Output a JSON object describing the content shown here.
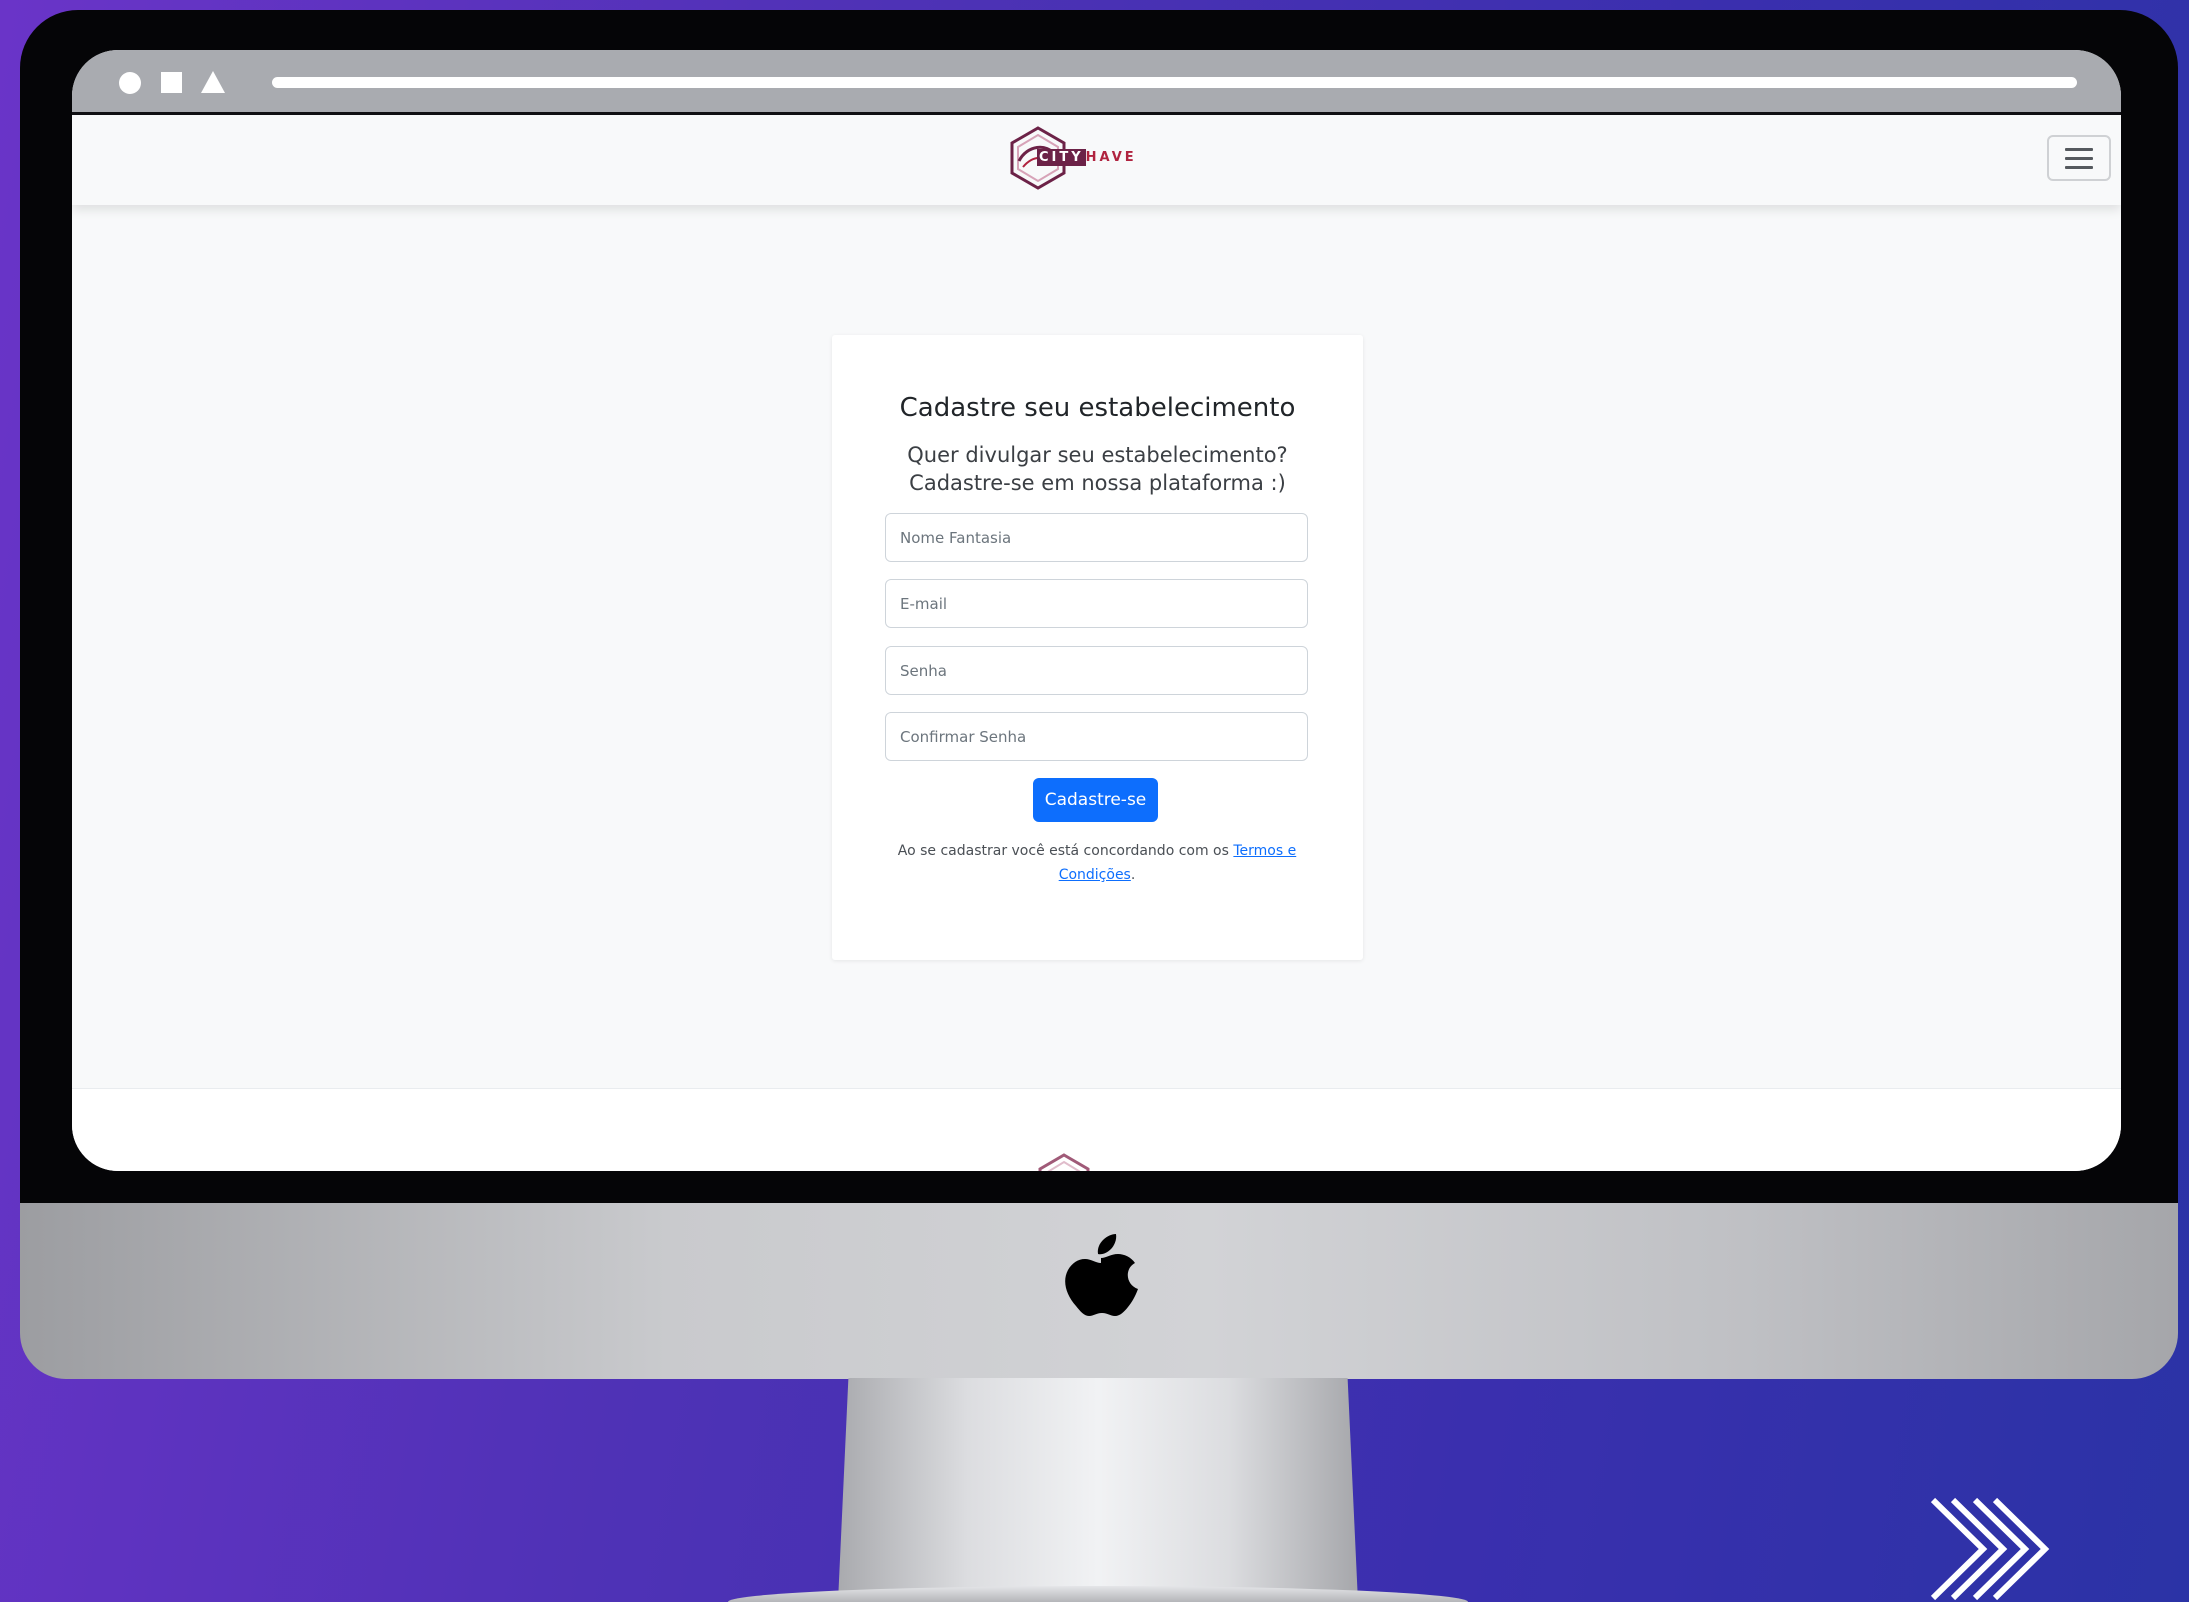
{
  "brand": {
    "logo_text_first": "CITY",
    "logo_text_rest": "HAVE"
  },
  "navbar": {
    "menu_icon": "hamburger-icon"
  },
  "signup": {
    "title": "Cadastre seu estabelecimento",
    "subtitle_line1": "Quer divulgar seu estabelecimento?",
    "subtitle_line2": "Cadastre-se em nossa plataforma :)",
    "fields": {
      "trade_name_placeholder": "Nome Fantasia",
      "email_placeholder": "E-mail",
      "password_placeholder": "Senha",
      "confirm_password_placeholder": "Confirmar Senha"
    },
    "submit_label": "Cadastre-se",
    "terms_text": "Ao se cadastrar você está concordando com os ",
    "terms_link": "Termos e Condições",
    "terms_end": "."
  },
  "colors": {
    "primary": "#0d6efd",
    "brand": "#b0233f",
    "background_gradient_start": "#6a34c8",
    "background_gradient_end": "#2b33a6"
  },
  "icons": {
    "window_controls": [
      "circle-icon",
      "square-icon",
      "triangle-icon"
    ],
    "device_logo": "apple-logo-icon",
    "corner": "double-chevron-right-icon"
  }
}
